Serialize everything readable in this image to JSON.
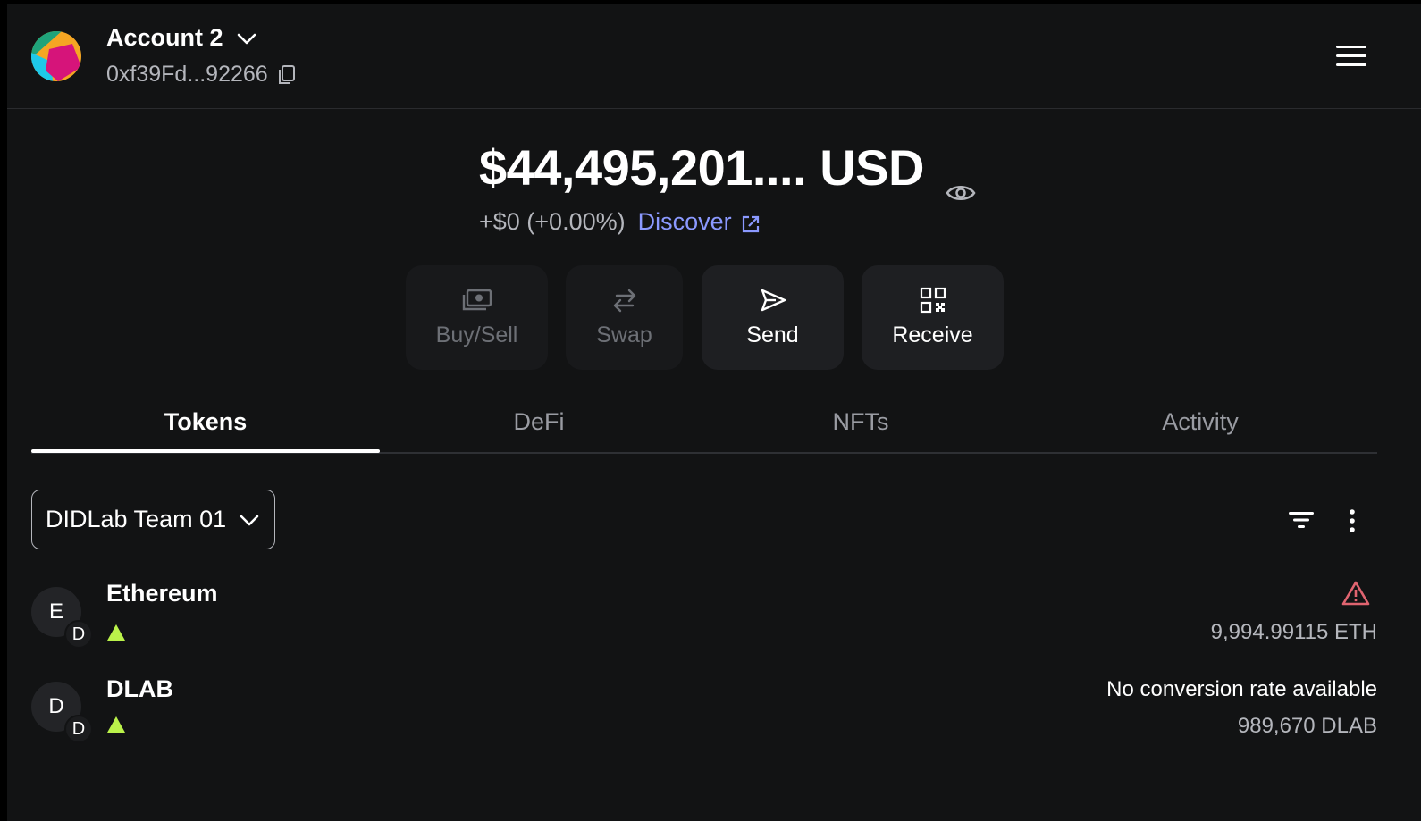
{
  "header": {
    "account_name": "Account 2",
    "address": "0xf39Fd...92266",
    "icons": {
      "avatar": "account-avatar",
      "dropdown": "chevron-down-icon",
      "copy": "copy-icon",
      "menu": "hamburger-menu-icon"
    }
  },
  "balance": {
    "amount": "$44,495,201.... USD",
    "change": "+$0 (+0.00%)",
    "discover_label": "Discover",
    "icons": {
      "visibility": "eye-icon",
      "external": "external-link-icon"
    }
  },
  "actions": [
    {
      "label": "Buy/Sell",
      "icon": "cash-icon",
      "enabled": false
    },
    {
      "label": "Swap",
      "icon": "swap-arrows-icon",
      "enabled": false
    },
    {
      "label": "Send",
      "icon": "send-icon",
      "enabled": true
    },
    {
      "label": "Receive",
      "icon": "qr-code-icon",
      "enabled": true
    }
  ],
  "tabs": [
    {
      "label": "Tokens",
      "active": true
    },
    {
      "label": "DeFi",
      "active": false
    },
    {
      "label": "NFTs",
      "active": false
    },
    {
      "label": "Activity",
      "active": false
    }
  ],
  "network_selector": {
    "value": "DIDLab Team 01"
  },
  "tokens": [
    {
      "avatar_letter": "E",
      "badge_letter": "D",
      "name": "Ethereum",
      "fiat": "",
      "amount": "9,994.99115 ETH",
      "warning": true
    },
    {
      "avatar_letter": "D",
      "badge_letter": "D",
      "name": "DLAB",
      "fiat": "No conversion rate available",
      "amount": "989,670 DLAB",
      "warning": false
    }
  ],
  "colors": {
    "background": "#121314",
    "accent_link": "#8b99ff",
    "warning": "#e06470",
    "positive": "#baf24a",
    "muted_text": "#b4b6bc"
  }
}
